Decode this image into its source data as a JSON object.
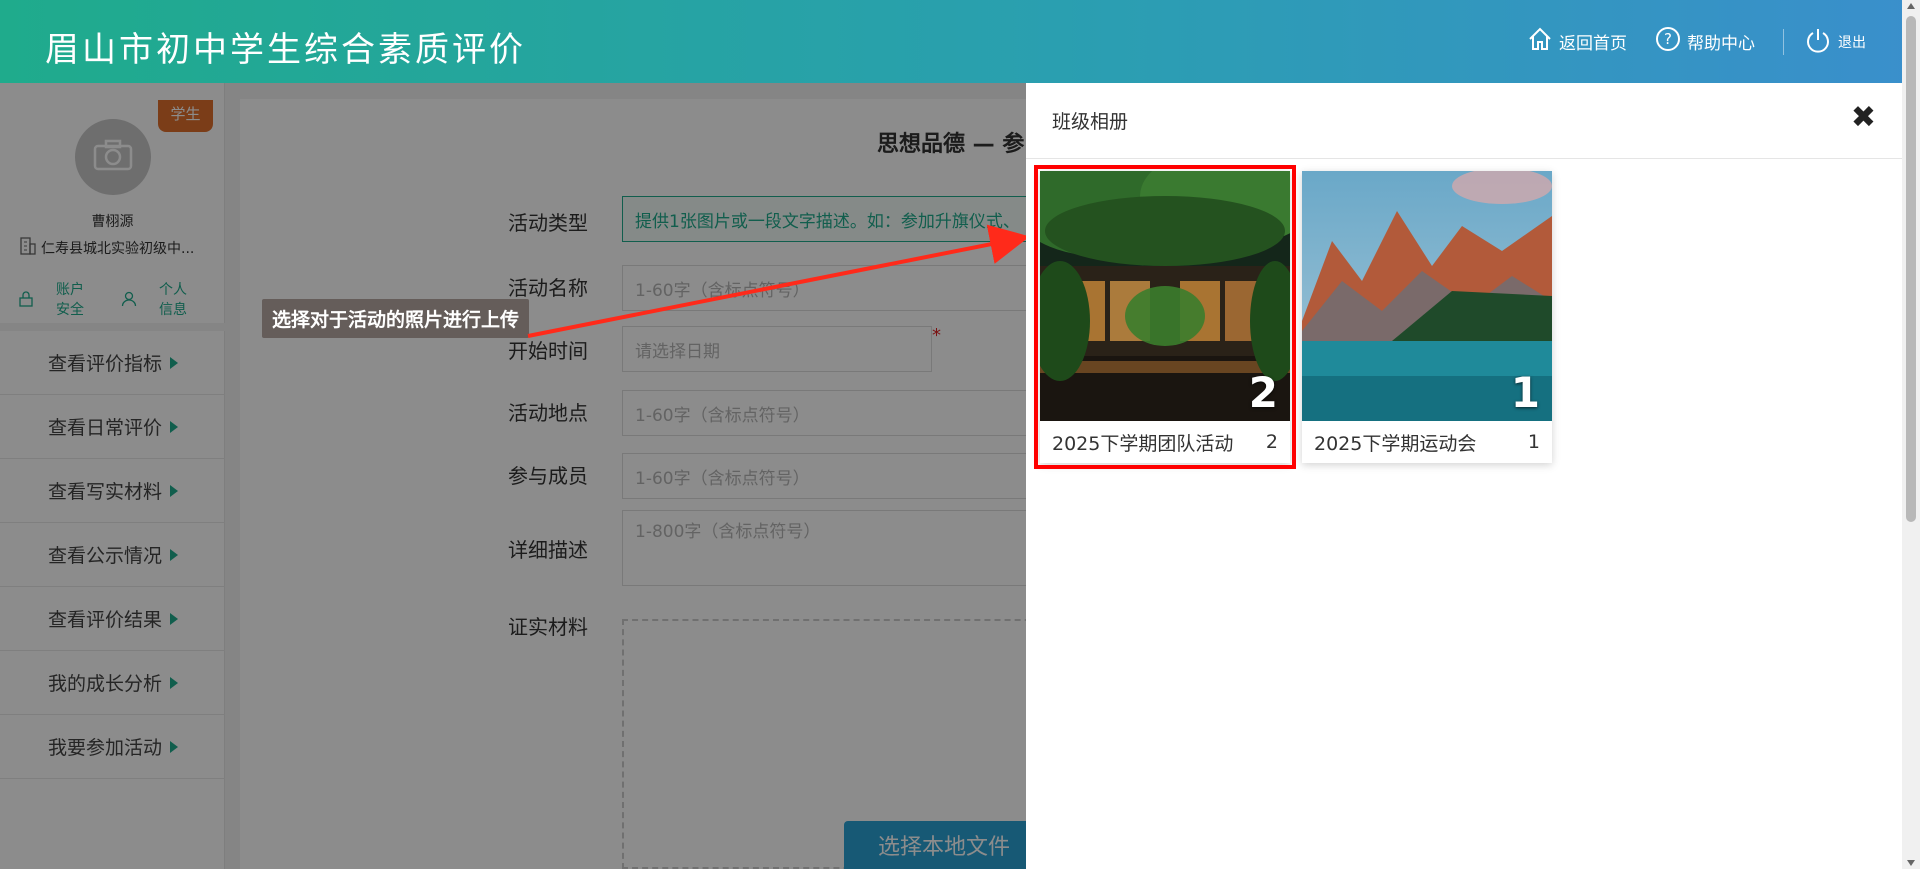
{
  "header": {
    "title": "眉山市初中学生综合素质评价",
    "nav": [
      {
        "label": "返回首页",
        "icon": "home-icon"
      },
      {
        "label": "帮助中心",
        "icon": "help-icon"
      },
      {
        "label": "退出",
        "icon": "power-icon"
      }
    ]
  },
  "sidebar": {
    "role_badge": "学生",
    "user_name": "曹栩源",
    "school": "仁寿县城北实验初级中...",
    "links": {
      "account_security": "账户安全",
      "personal_info": "个人信息"
    },
    "menu": [
      "查看评价指标",
      "查看日常评价",
      "查看写实材料",
      "查看公示情况",
      "查看评价结果",
      "我的成长分析",
      "我要参加活动"
    ]
  },
  "form": {
    "section_title": "思想品德 — 参",
    "fields": {
      "type_label": "活动类型",
      "type_hint": "提供1张图片或一段文字描述。如：参加升旗仪式、",
      "name_label": "活动名称",
      "name_placeholder": "1-60字（含标点符号）",
      "start_label": "开始时间",
      "start_placeholder": "请选择日期",
      "required_mark": "*",
      "place_label": "活动地点",
      "place_placeholder": "1-60字（含标点符号）",
      "members_label": "参与成员",
      "members_placeholder": "1-60字（含标点符号）",
      "desc_label": "详细描述",
      "desc_placeholder": "1-800字（含标点符号）",
      "evidence_label": "证实材料"
    },
    "upload_button": "选择本地文件"
  },
  "annotation": {
    "text": "选择对于活动的照片进行上传"
  },
  "album_panel": {
    "title": "班级相册",
    "close": "✖",
    "albums": [
      {
        "name": "2025下学期团队活动",
        "count": "2",
        "selected": true
      },
      {
        "name": "2025下学期运动会",
        "count": "1",
        "selected": false
      }
    ]
  },
  "colors": {
    "brand": "#1fab8c",
    "accent": "#2aa3d6",
    "highlight": "#ff0000",
    "badge": "#e0702c"
  }
}
